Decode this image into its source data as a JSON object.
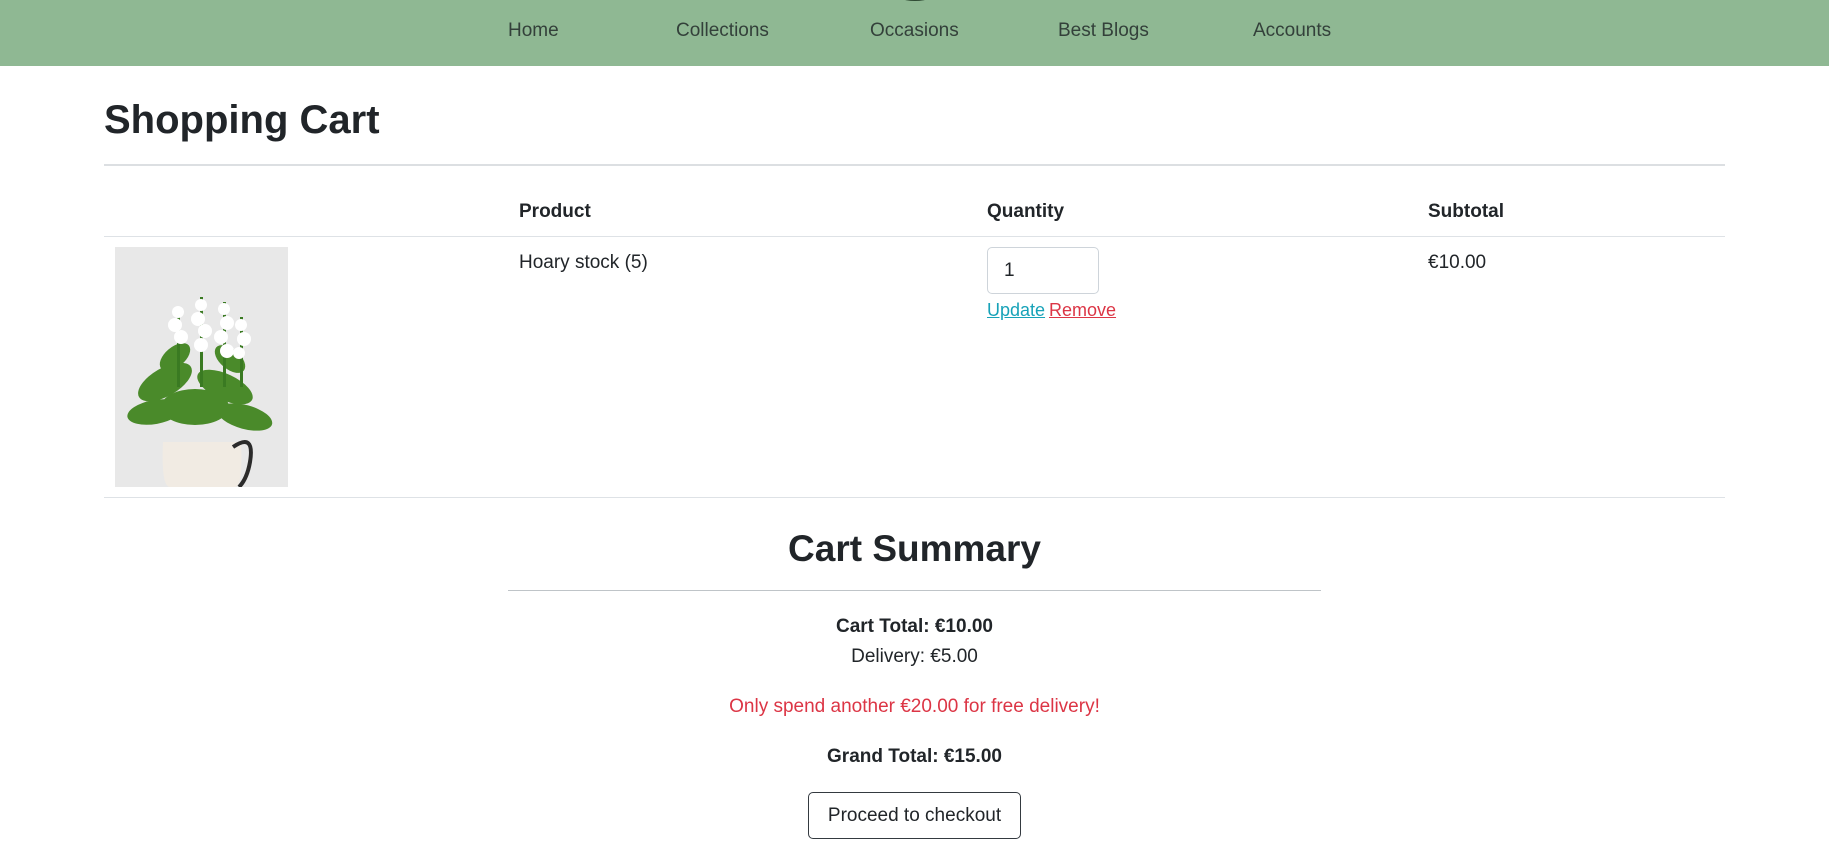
{
  "nav": {
    "items": [
      "Home",
      "Collections",
      "Occasions",
      "Best Blogs",
      "Accounts"
    ],
    "background": "#8fb893"
  },
  "page": {
    "title": "Shopping Cart"
  },
  "table": {
    "headers": [
      "Product",
      "Quantity",
      "Subtotal"
    ],
    "rows": [
      {
        "product_name": "Hoary stock (5)",
        "quantity": "1",
        "update_label": "Update",
        "remove_label": "Remove",
        "subtotal": "€10.00"
      }
    ]
  },
  "summary": {
    "title": "Cart Summary",
    "cart_total": "Cart Total: €10.00",
    "delivery": "Delivery: €5.00",
    "free_delivery_notice": "Only spend another €20.00 for free delivery!",
    "grand_total": "Grand Total: €15.00",
    "checkout_label": "Proceed to checkout"
  },
  "colors": {
    "update_link": "#17a2b8",
    "remove_link": "#dc3545",
    "notice": "#dc3545"
  }
}
